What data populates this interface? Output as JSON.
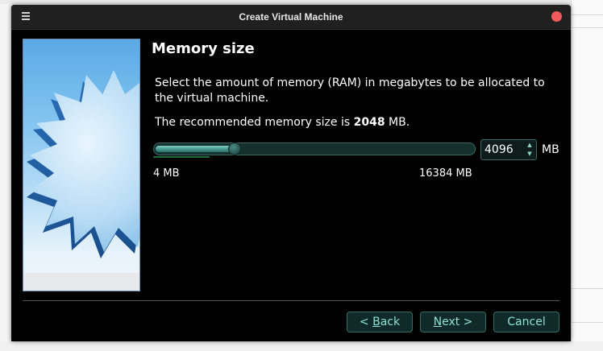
{
  "dialog": {
    "title": "Create Virtual Machine",
    "heading": "Memory size",
    "description": "Select the amount of memory (RAM) in megabytes to be allocated to the virtual machine.",
    "recommend_prefix": "The recommended memory size is ",
    "recommend_value": "2048",
    "recommend_suffix": " MB."
  },
  "memory": {
    "value": "4096",
    "unit": "MB",
    "min_label": "4 MB",
    "max_label": "16384 MB",
    "slider": {
      "min": 4,
      "max": 16384,
      "value": 4096,
      "recommended": 2048
    }
  },
  "buttons": {
    "back": {
      "prefix": "< ",
      "mnemonic": "B",
      "rest": "ack"
    },
    "next": {
      "mnemonic": "N",
      "rest": "ext >"
    },
    "cancel": "Cancel"
  },
  "colors": {
    "accent": "#8ee0d4",
    "close": "#f05a5a",
    "background": "#000000"
  },
  "icons": {
    "menu": "hamburger-menu-icon",
    "close": "close-circle-icon"
  }
}
